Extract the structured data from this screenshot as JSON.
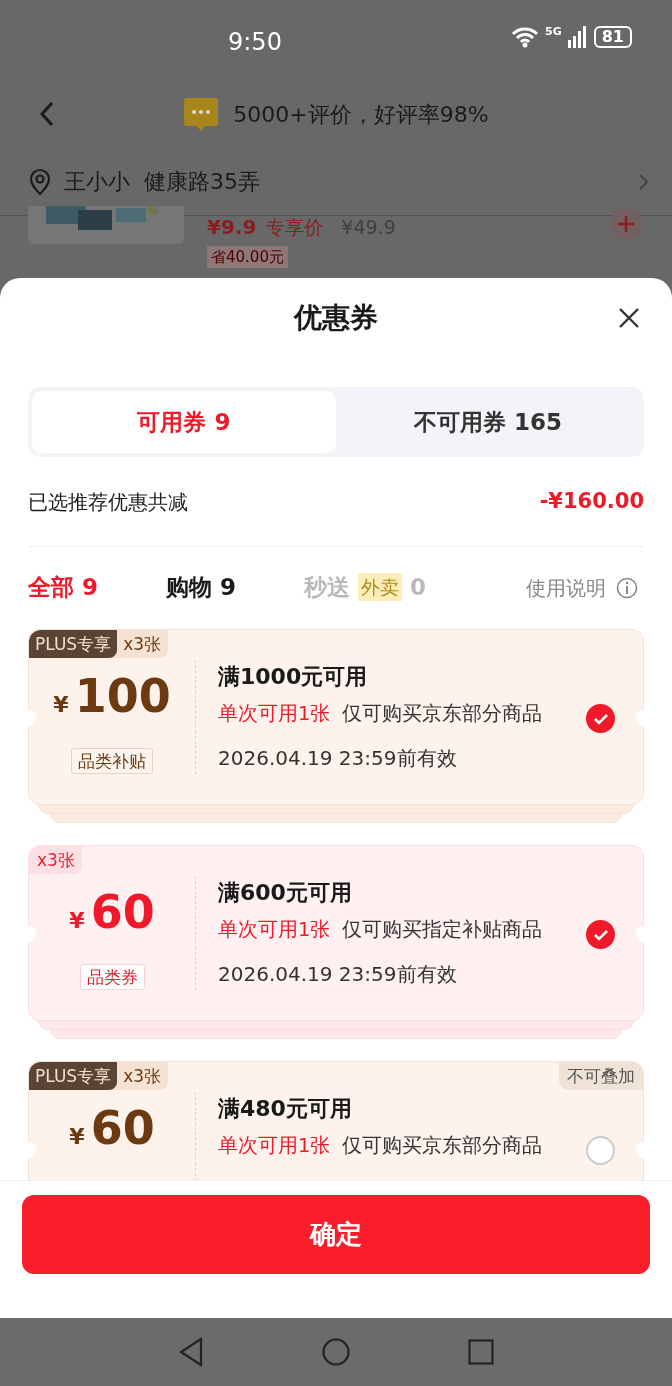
{
  "status_bar": {
    "time": "9:50",
    "network": "5G",
    "battery": "81"
  },
  "header": {
    "review_summary": "5000+评价，好评率98%"
  },
  "address": {
    "name": "王小小",
    "street": "健康路35弄"
  },
  "product": {
    "price": "¥9.9",
    "price_label": "专享价",
    "original_price": "¥49.9",
    "saving": "省40.00元"
  },
  "sheet": {
    "title": "优惠券",
    "tabs": [
      {
        "label": "可用券 9",
        "selected": true
      },
      {
        "label": "不可用券 165",
        "selected": false
      }
    ],
    "summary": {
      "label": "已选推荐优惠共减",
      "amount": "-¥160.00"
    },
    "filters": [
      {
        "label": "全部",
        "count": "9",
        "selected": true,
        "disabled": false
      },
      {
        "label": "购物",
        "count": "9",
        "selected": false,
        "disabled": false
      },
      {
        "label": "秒送",
        "tag": "外卖",
        "count": "0",
        "selected": false,
        "disabled": true
      }
    ],
    "help_link": "使用说明",
    "coupons": [
      {
        "kind": "plus",
        "badges": [
          {
            "kind": "plus",
            "text": "PLUS专享"
          },
          {
            "kind": "count",
            "text": "x3张"
          }
        ],
        "currency": "¥",
        "amount": "100",
        "category": "品类补贴",
        "condition": "满1000元可用",
        "limit": "单次可用1张",
        "scope": "仅可购买京东部分商品",
        "expiry": "2026.04.19 23:59前有效",
        "checked": true,
        "stacked": true
      },
      {
        "kind": "regular",
        "badges": [
          {
            "kind": "count",
            "text": "x3张"
          }
        ],
        "currency": "¥",
        "amount": "60",
        "category": "品类券",
        "condition": "满600元可用",
        "limit": "单次可用1张",
        "scope": "仅可购买指定补贴商品",
        "expiry": "2026.04.19 23:59前有效",
        "checked": true,
        "stacked": true
      },
      {
        "kind": "plus",
        "badges": [
          {
            "kind": "plus",
            "text": "PLUS专享"
          },
          {
            "kind": "count",
            "text": "x3张"
          }
        ],
        "corner_tag": "不可叠加",
        "currency": "¥",
        "amount": "60",
        "condition": "满480元可用",
        "limit": "单次可用1张",
        "scope": "仅可购买京东部分商品",
        "checked": false
      }
    ],
    "confirm_button": "确定"
  }
}
